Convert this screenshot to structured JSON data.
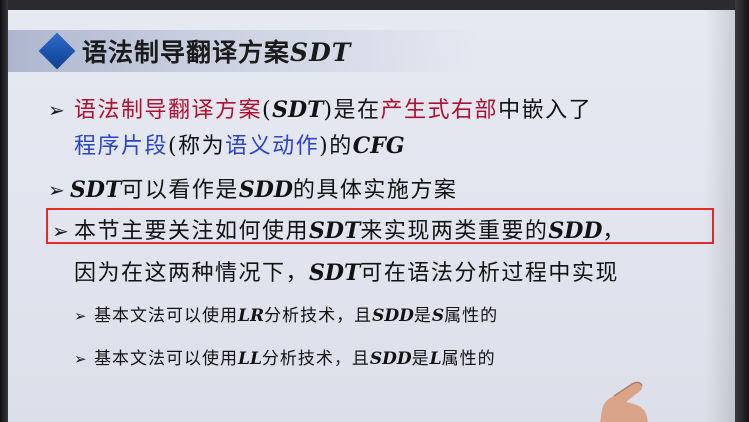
{
  "slide": {
    "title_cn": "语法制导翻译方案",
    "title_latin": "SDT",
    "bullets": [
      {
        "parts": [
          {
            "t": "语法制导翻译方案",
            "c": "red"
          },
          {
            "t": "(",
            "c": ""
          },
          {
            "t": "SDT",
            "c": "it"
          },
          {
            "t": ")是在",
            "c": ""
          },
          {
            "t": "产生式右部",
            "c": "red"
          },
          {
            "t": "中嵌入了",
            "c": ""
          }
        ]
      },
      {
        "parts": [
          {
            "t": "程序片段",
            "c": "blue"
          },
          {
            "t": "(称为",
            "c": ""
          },
          {
            "t": "语义动作",
            "c": "blue"
          },
          {
            "t": ")的",
            "c": ""
          },
          {
            "t": "CFG",
            "c": "it"
          }
        ]
      },
      {
        "parts": [
          {
            "t": "SDT",
            "c": "it"
          },
          {
            "t": "可以看作是",
            "c": ""
          },
          {
            "t": "SDD",
            "c": "it"
          },
          {
            "t": "的具体实施方案",
            "c": ""
          }
        ]
      },
      {
        "parts": [
          {
            "t": "本节主要关注如何使用",
            "c": ""
          },
          {
            "t": "SDT",
            "c": "it"
          },
          {
            "t": "来实现两类重要的",
            "c": ""
          },
          {
            "t": "SDD",
            "c": "it"
          },
          {
            "t": "，",
            "c": ""
          }
        ]
      },
      {
        "parts": [
          {
            "t": "因为在这两种情况下，",
            "c": ""
          },
          {
            "t": "SDT",
            "c": "it"
          },
          {
            "t": "可在语法分析过程中实现",
            "c": ""
          }
        ]
      }
    ],
    "subbullets": [
      {
        "parts": [
          {
            "t": "基本文法可以使用",
            "c": ""
          },
          {
            "t": "LR",
            "c": "it"
          },
          {
            "t": "分析技术，且",
            "c": ""
          },
          {
            "t": "SDD",
            "c": "it"
          },
          {
            "t": "是",
            "c": ""
          },
          {
            "t": "S",
            "c": "it"
          },
          {
            "t": "属性的",
            "c": ""
          }
        ]
      },
      {
        "parts": [
          {
            "t": "基本文法可以使用",
            "c": ""
          },
          {
            "t": "LL",
            "c": "it"
          },
          {
            "t": "分析技术，且",
            "c": ""
          },
          {
            "t": "SDD",
            "c": "it"
          },
          {
            "t": "是",
            "c": ""
          },
          {
            "t": "L",
            "c": "it"
          },
          {
            "t": "属性的",
            "c": ""
          }
        ]
      }
    ]
  },
  "colors": {
    "accent_red": "#b01030",
    "accent_blue": "#2a45c8",
    "highlight_box": "#e32b2b",
    "title_bullet": "#1e56b0"
  },
  "icons": {
    "bullet": "arrow-right-icon",
    "title_bullet": "diamond-icon"
  }
}
